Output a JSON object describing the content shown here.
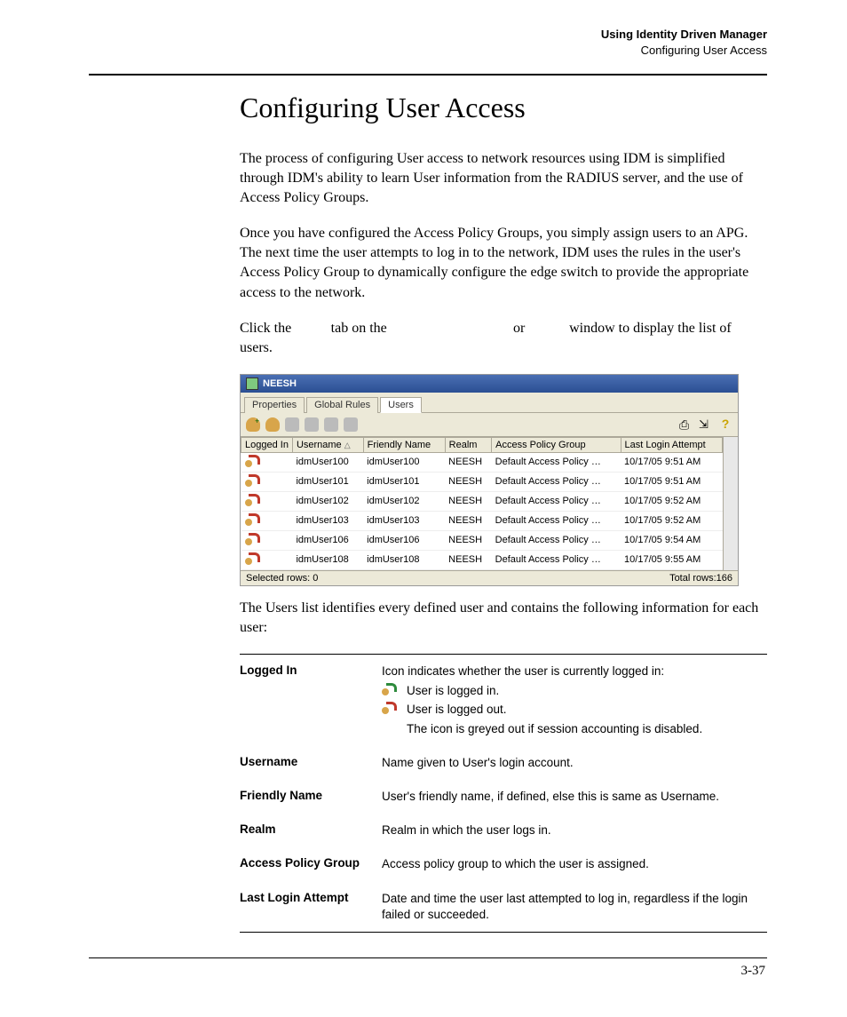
{
  "running_head": {
    "line1": "Using Identity Driven Manager",
    "line2": "Configuring User Access"
  },
  "title": "Configuring User Access",
  "paragraphs": {
    "p1": "The process of configuring User access to network resources using IDM is simplified through IDM's ability to learn User information from the RADIUS server, and the use of Access Policy Groups.",
    "p2": "Once you have configured the Access Policy Groups, you simply assign users to an APG. The next time the user attempts to log in to the network, IDM uses the rules in the user's Access Policy Group to dynamically configure the edge switch to provide the appropriate access to the network.",
    "p3_a": "Click the ",
    "p3_b": " tab on the ",
    "p3_c": " or ",
    "p3_d": " window to display the list of users.",
    "p4": "The Users list identifies every defined user and contains the following information for each user:"
  },
  "screenshot": {
    "window_title": "NEESH",
    "tabs": [
      "Properties",
      "Global Rules",
      "Users"
    ],
    "active_tab_index": 2,
    "columns": [
      "Logged In",
      "Username",
      "Friendly Name",
      "Realm",
      "Access Policy Group",
      "Last Login Attempt"
    ],
    "rows": [
      {
        "username": "idmUser100",
        "friendly": "idmUser100",
        "realm": "NEESH",
        "apg": "Default Access Policy …",
        "last": "10/17/05 9:51 AM"
      },
      {
        "username": "idmUser101",
        "friendly": "idmUser101",
        "realm": "NEESH",
        "apg": "Default Access Policy …",
        "last": "10/17/05 9:51 AM"
      },
      {
        "username": "idmUser102",
        "friendly": "idmUser102",
        "realm": "NEESH",
        "apg": "Default Access Policy …",
        "last": "10/17/05 9:52 AM"
      },
      {
        "username": "idmUser103",
        "friendly": "idmUser103",
        "realm": "NEESH",
        "apg": "Default Access Policy …",
        "last": "10/17/05 9:52 AM"
      },
      {
        "username": "idmUser106",
        "friendly": "idmUser106",
        "realm": "NEESH",
        "apg": "Default Access Policy …",
        "last": "10/17/05 9:54 AM"
      },
      {
        "username": "idmUser108",
        "friendly": "idmUser108",
        "realm": "NEESH",
        "apg": "Default Access Policy …",
        "last": "10/17/05 9:55 AM"
      }
    ],
    "status_left": "Selected rows: 0",
    "status_right": "Total rows:166"
  },
  "definitions": [
    {
      "label": "Logged In",
      "value": "Icon indicates whether the user is currently logged in:",
      "sub": [
        "User is logged in.",
        "User is logged out.",
        "The icon is greyed out if session accounting is disabled."
      ]
    },
    {
      "label": "Username",
      "value": "Name given to User's login account."
    },
    {
      "label": "Friendly Name",
      "value": "User's friendly name, if defined, else this is same as Username."
    },
    {
      "label": "Realm",
      "value": "Realm in which the user logs in."
    },
    {
      "label": "Access Policy Group",
      "value": "Access policy group to which the user is assigned."
    },
    {
      "label": "Last Login Attempt",
      "value": "Date and time the user last attempted to log in, regardless if the login failed or succeeded."
    }
  ],
  "page_number": "3-37"
}
